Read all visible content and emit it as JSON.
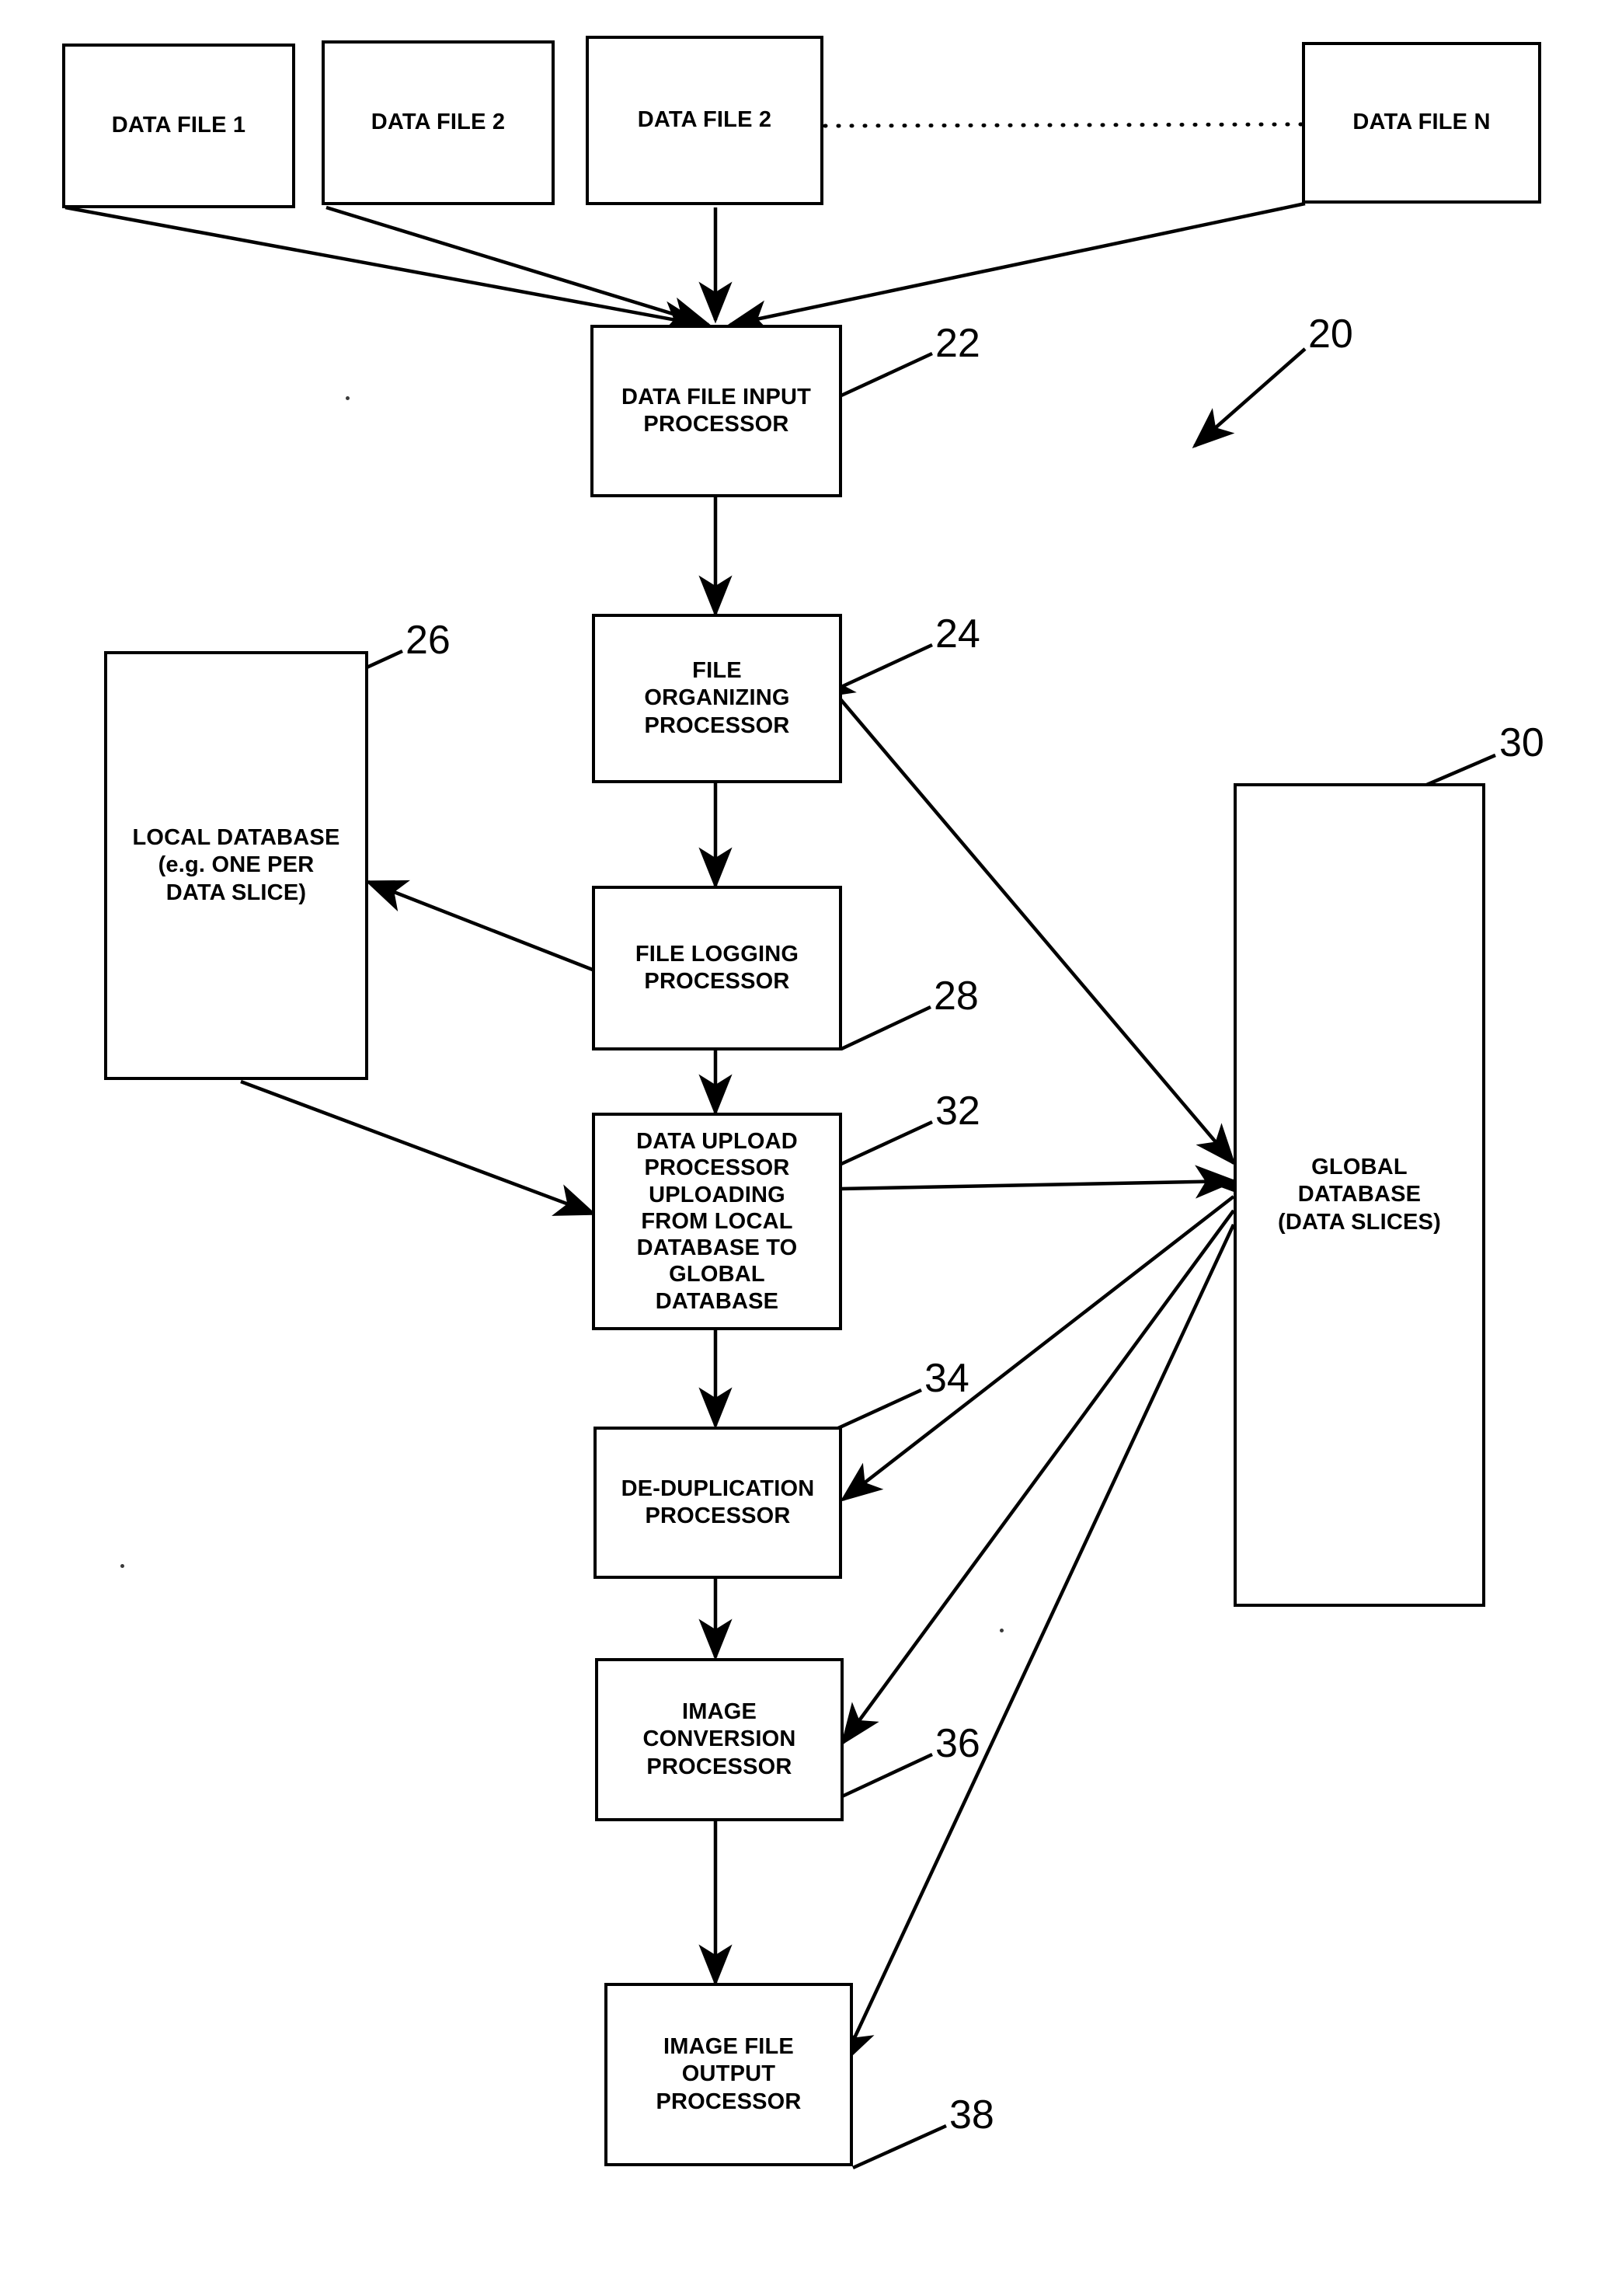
{
  "figure": {
    "kind": "patent-flow-diagram",
    "system_reference": "20",
    "ink_color": "#000000",
    "background_color": "#ffffff"
  },
  "nodes": {
    "data_file_1": {
      "label": "DATA FILE 1"
    },
    "data_file_2a": {
      "label": "DATA FILE 2"
    },
    "data_file_2b": {
      "label": "DATA FILE 2"
    },
    "data_file_n": {
      "label": "DATA FILE N"
    },
    "input_processor": {
      "label": "DATA FILE INPUT\nPROCESSOR",
      "ref": "22"
    },
    "organizing_processor": {
      "label": "FILE\nORGANIZING\nPROCESSOR",
      "ref": "24"
    },
    "local_database": {
      "label": "LOCAL DATABASE\n(e.g. ONE PER\nDATA SLICE)",
      "ref": "26"
    },
    "logging_processor": {
      "label": "FILE LOGGING\nPROCESSOR",
      "ref": "28"
    },
    "global_database": {
      "label": "GLOBAL\nDATABASE\n(DATA SLICES)",
      "ref": "30"
    },
    "upload_processor": {
      "label": "DATA UPLOAD\nPROCESSOR\nUPLOADING\nFROM LOCAL\nDATABASE TO\nGLOBAL\nDATABASE",
      "ref": "32"
    },
    "dedup_processor": {
      "label": "DE-DUPLICATION\nPROCESSOR",
      "ref": "34"
    },
    "conversion_processor": {
      "label": "IMAGE\nCONVERSION\nPROCESSOR",
      "ref": "36"
    },
    "output_processor": {
      "label": "IMAGE FILE\nOUTPUT\nPROCESSOR",
      "ref": "38"
    }
  },
  "reference_numerals": [
    {
      "id": "20",
      "value": "20"
    },
    {
      "id": "22",
      "value": "22"
    },
    {
      "id": "24",
      "value": "24"
    },
    {
      "id": "26",
      "value": "26"
    },
    {
      "id": "28",
      "value": "28"
    },
    {
      "id": "30",
      "value": "30"
    },
    {
      "id": "32",
      "value": "32"
    },
    {
      "id": "34",
      "value": "34"
    },
    {
      "id": "36",
      "value": "36"
    },
    {
      "id": "38",
      "value": "38"
    }
  ],
  "connections": [
    {
      "from": "data_file_1",
      "to": "input_processor",
      "style": "solid-arrow"
    },
    {
      "from": "data_file_2a",
      "to": "input_processor",
      "style": "solid-arrow"
    },
    {
      "from": "data_file_2b",
      "to": "input_processor",
      "style": "solid-arrow"
    },
    {
      "from": "data_file_n",
      "to": "input_processor",
      "style": "solid-arrow"
    },
    {
      "from": "data_file_2b",
      "to": "data_file_n",
      "style": "dotted-continuation"
    },
    {
      "from": "input_processor",
      "to": "organizing_processor",
      "style": "solid-arrow"
    },
    {
      "from": "organizing_processor",
      "to": "logging_processor",
      "style": "solid-arrow"
    },
    {
      "from": "logging_processor",
      "to": "local_database",
      "style": "solid-arrow"
    },
    {
      "from": "logging_processor",
      "to": "upload_processor",
      "style": "solid-arrow"
    },
    {
      "from": "local_database",
      "to": "upload_processor",
      "style": "solid-arrow"
    },
    {
      "from": "organizing_processor",
      "to": "global_database",
      "style": "double-arrow"
    },
    {
      "from": "upload_processor",
      "to": "global_database",
      "style": "solid-arrow"
    },
    {
      "from": "upload_processor",
      "to": "dedup_processor",
      "style": "solid-arrow"
    },
    {
      "from": "global_database",
      "to": "dedup_processor",
      "style": "double-arrow"
    },
    {
      "from": "dedup_processor",
      "to": "conversion_processor",
      "style": "solid-arrow"
    },
    {
      "from": "global_database",
      "to": "conversion_processor",
      "style": "solid-arrow"
    },
    {
      "from": "conversion_processor",
      "to": "output_processor",
      "style": "solid-arrow"
    },
    {
      "from": "global_database",
      "to": "output_processor",
      "style": "solid-arrow"
    }
  ]
}
